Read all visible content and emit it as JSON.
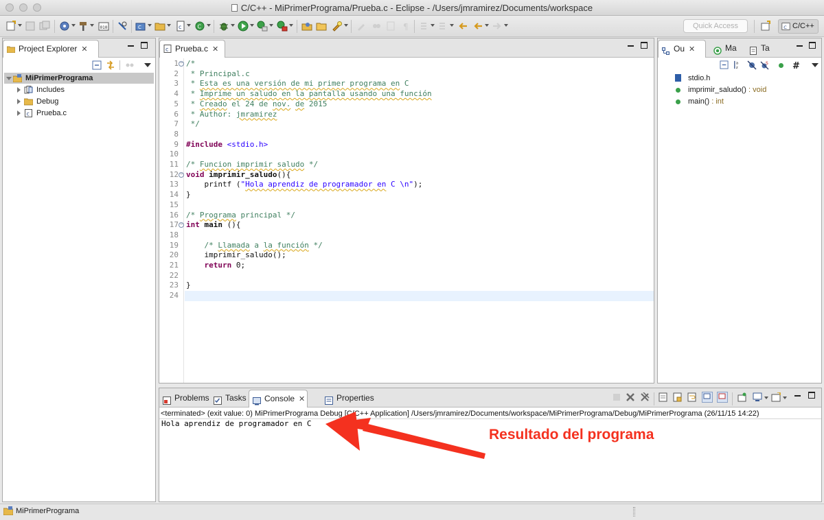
{
  "window": {
    "title": "C/C++ - MiPrimerPrograma/Prueba.c - Eclipse - /Users/jmramirez/Documents/workspace"
  },
  "toolbar": {
    "quick_access_placeholder": "Quick Access",
    "perspective_label": "C/C++"
  },
  "project_explorer": {
    "tab_label": "Project Explorer",
    "items": [
      {
        "label": "MiPrimerPrograma",
        "depth": 0,
        "expanded": true,
        "selected": true,
        "icon": "project-icon"
      },
      {
        "label": "Includes",
        "depth": 1,
        "expanded": false,
        "icon": "includes-icon"
      },
      {
        "label": "Debug",
        "depth": 1,
        "expanded": false,
        "icon": "folder-icon"
      },
      {
        "label": "Prueba.c",
        "depth": 1,
        "expanded": false,
        "icon": "c-file-icon"
      }
    ]
  },
  "editor": {
    "tab_label": "Prueba.c",
    "current_line": 24,
    "lines": [
      {
        "n": "1",
        "fold": true,
        "spans": [
          {
            "c": "cm",
            "t": "/*"
          }
        ]
      },
      {
        "n": "2",
        "spans": [
          {
            "c": "cm",
            "t": " * Principal.c"
          }
        ]
      },
      {
        "n": "3",
        "spans": [
          {
            "c": "cm",
            "t": " * "
          },
          {
            "c": "cm sq",
            "t": "Esta es una versión de mi primer programa en"
          },
          {
            "c": "cm",
            "t": " C"
          }
        ]
      },
      {
        "n": "4",
        "spans": [
          {
            "c": "cm",
            "t": " * "
          },
          {
            "c": "cm sq",
            "t": "Imprime un saludo en la pantalla usando una función"
          }
        ]
      },
      {
        "n": "5",
        "spans": [
          {
            "c": "cm",
            "t": " * "
          },
          {
            "c": "cm sq",
            "t": "Creado"
          },
          {
            "c": "cm",
            "t": " el 24 de "
          },
          {
            "c": "cm sq",
            "t": "nov."
          },
          {
            "c": "cm",
            "t": " "
          },
          {
            "c": "cm sq",
            "t": "de"
          },
          {
            "c": "cm",
            "t": " 2015"
          }
        ]
      },
      {
        "n": "6",
        "spans": [
          {
            "c": "cm",
            "t": " * Author: "
          },
          {
            "c": "cm sq",
            "t": "jmramirez"
          }
        ]
      },
      {
        "n": "7",
        "spans": [
          {
            "c": "cm",
            "t": " */"
          }
        ]
      },
      {
        "n": "8",
        "spans": []
      },
      {
        "n": "9",
        "spans": [
          {
            "c": "pp",
            "t": "#include"
          },
          {
            "c": "",
            "t": " "
          },
          {
            "c": "str",
            "t": "<stdio.h>"
          }
        ]
      },
      {
        "n": "10",
        "spans": []
      },
      {
        "n": "11",
        "spans": [
          {
            "c": "cm",
            "t": "/* "
          },
          {
            "c": "cm sq",
            "t": "Funcion imprimir saludo"
          },
          {
            "c": "cm",
            "t": " */"
          }
        ]
      },
      {
        "n": "12",
        "fold": true,
        "spans": [
          {
            "c": "kw",
            "t": "void"
          },
          {
            "c": "",
            "t": " "
          },
          {
            "c": "fn",
            "t": "imprimir_saludo"
          },
          {
            "c": "",
            "t": "(){"
          }
        ]
      },
      {
        "n": "13",
        "spans": [
          {
            "c": "",
            "t": "    printf ("
          },
          {
            "c": "str",
            "t": "\""
          },
          {
            "c": "str sq",
            "t": "Hola aprendiz de programador en"
          },
          {
            "c": "str",
            "t": " C \\n\""
          },
          {
            "c": "",
            "t": ");"
          }
        ]
      },
      {
        "n": "14",
        "spans": [
          {
            "c": "",
            "t": "}"
          }
        ]
      },
      {
        "n": "15",
        "spans": []
      },
      {
        "n": "16",
        "spans": [
          {
            "c": "cm",
            "t": "/* "
          },
          {
            "c": "cm sq",
            "t": "Programa"
          },
          {
            "c": "cm",
            "t": " principal */"
          }
        ]
      },
      {
        "n": "17",
        "fold": true,
        "spans": [
          {
            "c": "kw",
            "t": "int"
          },
          {
            "c": "",
            "t": " "
          },
          {
            "c": "fn",
            "t": "main"
          },
          {
            "c": "",
            "t": " (){"
          }
        ]
      },
      {
        "n": "18",
        "spans": []
      },
      {
        "n": "19",
        "spans": [
          {
            "c": "",
            "t": "    "
          },
          {
            "c": "cm",
            "t": "/* "
          },
          {
            "c": "cm sq",
            "t": "Llamada"
          },
          {
            "c": "cm",
            "t": " a "
          },
          {
            "c": "cm sq",
            "t": "la función"
          },
          {
            "c": "cm",
            "t": " */"
          }
        ]
      },
      {
        "n": "20",
        "spans": [
          {
            "c": "",
            "t": "    imprimir_saludo();"
          }
        ]
      },
      {
        "n": "21",
        "spans": [
          {
            "c": "",
            "t": "    "
          },
          {
            "c": "kw",
            "t": "return"
          },
          {
            "c": "",
            "t": " 0;"
          }
        ]
      },
      {
        "n": "22",
        "spans": []
      },
      {
        "n": "23",
        "spans": [
          {
            "c": "",
            "t": "}"
          }
        ]
      },
      {
        "n": "24",
        "spans": []
      }
    ]
  },
  "outline": {
    "tabs": [
      {
        "label": "Ou",
        "icon": "outline-icon",
        "active": true,
        "closable": true
      },
      {
        "label": "Ma",
        "icon": "make-target-icon",
        "active": false
      },
      {
        "label": "Ta",
        "icon": "task-list-icon",
        "active": false
      }
    ],
    "items": [
      {
        "name": "stdio.h",
        "type": "",
        "icon": "include-icon"
      },
      {
        "name": "imprimir_saludo()",
        "type": " : void",
        "icon": "function-icon"
      },
      {
        "name": "main()",
        "type": " : int",
        "icon": "function-icon"
      }
    ]
  },
  "bottom_panel": {
    "tabs": [
      {
        "label": "Problems",
        "icon": "problems-icon",
        "active": false
      },
      {
        "label": "Tasks",
        "icon": "tasks-icon",
        "active": false
      },
      {
        "label": "Console",
        "icon": "console-icon",
        "active": true
      },
      {
        "label": "Properties",
        "icon": "properties-icon",
        "active": false
      }
    ],
    "status": "<terminated> (exit value: 0) MiPrimerPrograma Debug [C/C++ Application] /Users/jmramirez/Documents/workspace/MiPrimerPrograma/Debug/MiPrimerPrograma (26/11/15 14:22)",
    "output": "Hola aprendiz de programador en C"
  },
  "statusbar": {
    "selection": "MiPrimerPrograma"
  },
  "annotation": {
    "text": "Resultado del programa",
    "color": "#f4311f"
  },
  "colors": {
    "comment": "#3f7f5f",
    "keyword": "#7f0055",
    "string": "#2a00ff",
    "current_line": "#e8f2fe"
  }
}
